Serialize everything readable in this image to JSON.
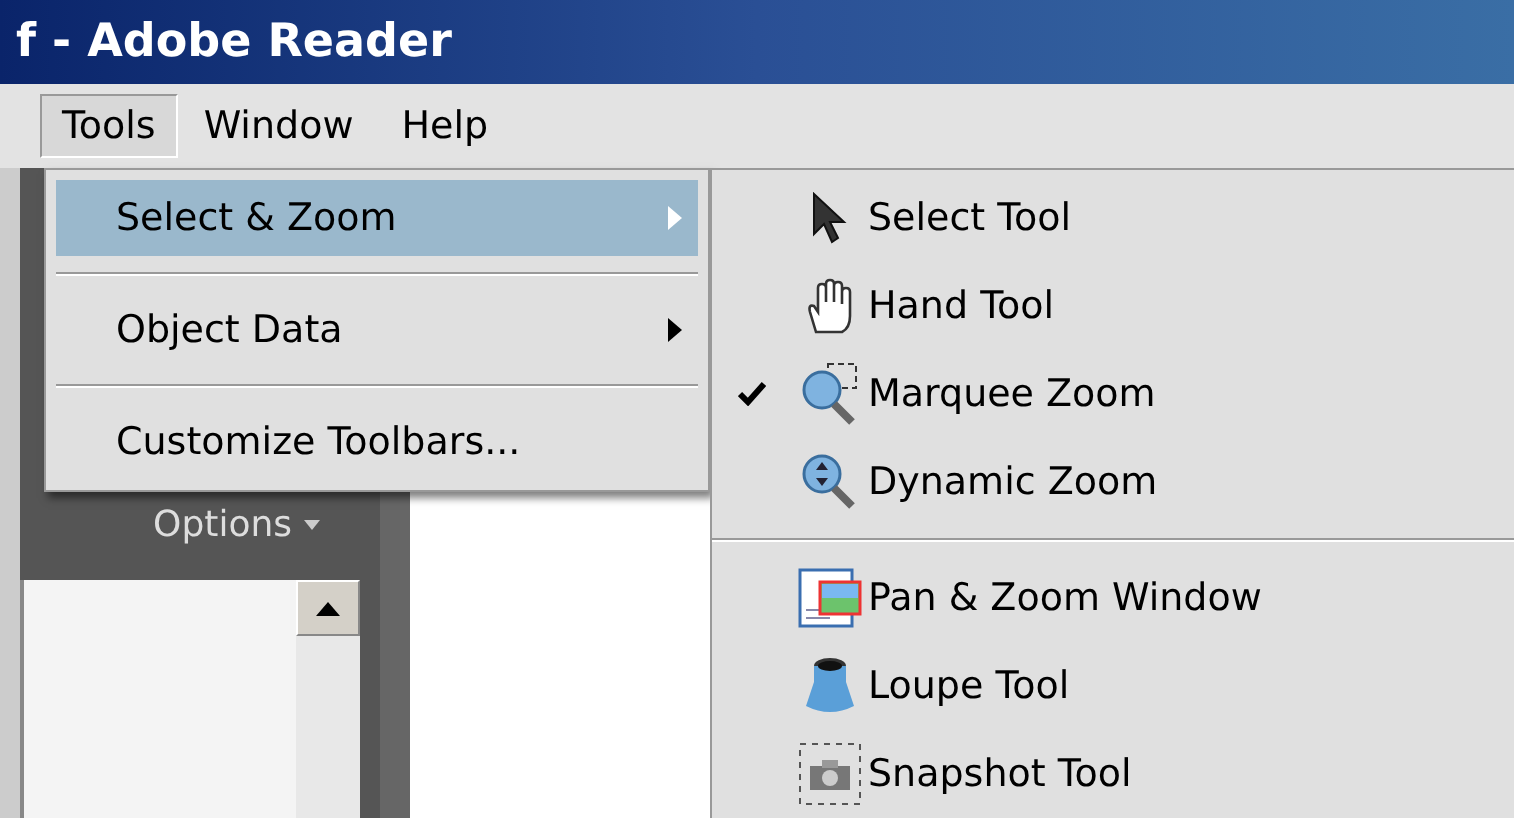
{
  "window": {
    "title": "f - Adobe Reader"
  },
  "menu_bar": [
    {
      "label": "Tools",
      "selected": true
    },
    {
      "label": "Window",
      "selected": false
    },
    {
      "label": "Help",
      "selected": false
    }
  ],
  "side_panel": {
    "options_label": "Options"
  },
  "tools_menu": [
    {
      "label": "Select & Zoom",
      "selected": true,
      "submenu": true
    },
    {
      "kind": "separator"
    },
    {
      "label": "Object Data",
      "selected": false,
      "submenu": true
    },
    {
      "kind": "separator"
    },
    {
      "label": "Customize Toolbars...",
      "selected": false,
      "submenu": false
    }
  ],
  "submenu": [
    {
      "kind": "item",
      "label": "Select Tool",
      "checked": false
    },
    {
      "kind": "item",
      "label": "Hand Tool",
      "checked": false
    },
    {
      "kind": "item",
      "label": "Marquee Zoom",
      "checked": true
    },
    {
      "kind": "item",
      "label": "Dynamic Zoom",
      "checked": false
    },
    {
      "kind": "separator"
    },
    {
      "kind": "item",
      "label": "Pan & Zoom Window",
      "checked": false
    },
    {
      "kind": "item",
      "label": "Loupe Tool",
      "checked": false
    },
    {
      "kind": "item",
      "label": "Snapshot Tool",
      "checked": false
    }
  ]
}
